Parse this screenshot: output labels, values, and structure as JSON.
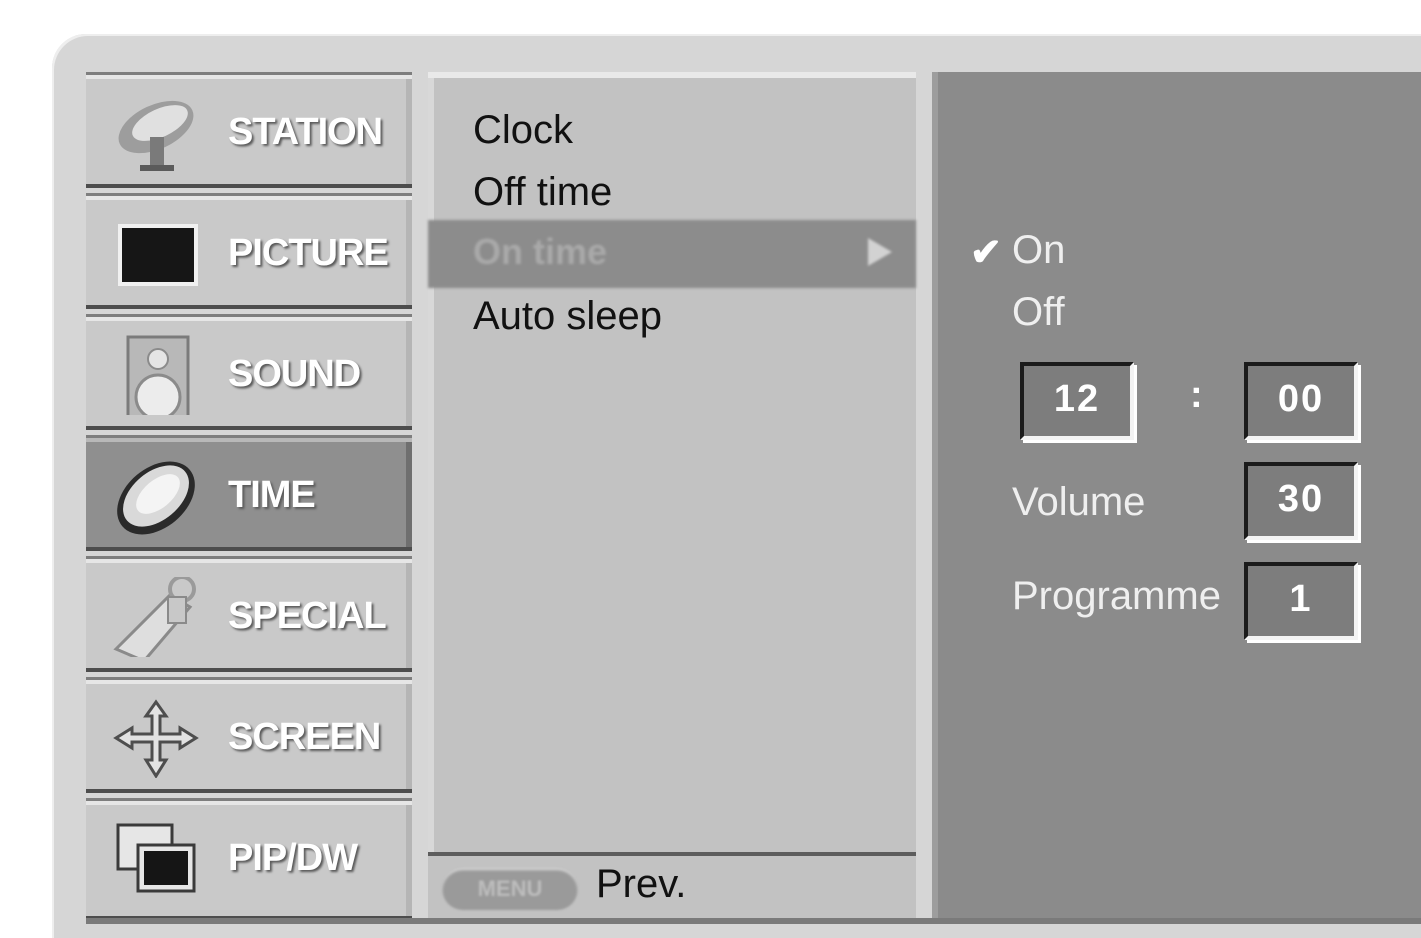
{
  "categories": [
    {
      "label": "STATION",
      "icon": "satellite-dish-icon",
      "active": false
    },
    {
      "label": "PICTURE",
      "icon": "picture-screen-icon",
      "active": false
    },
    {
      "label": "SOUND",
      "icon": "speaker-icon",
      "active": false
    },
    {
      "label": "TIME",
      "icon": "clock-icon",
      "active": true
    },
    {
      "label": "SPECIAL",
      "icon": "remote-hand-icon",
      "active": false
    },
    {
      "label": "SCREEN",
      "icon": "move-arrows-icon",
      "active": false
    },
    {
      "label": "PIP/DW",
      "icon": "pip-windows-icon",
      "active": false
    }
  ],
  "submenu": {
    "items": [
      {
        "label": "Clock",
        "selected": false
      },
      {
        "label": "Off time",
        "selected": false
      },
      {
        "label": "On time",
        "selected": true
      },
      {
        "label": "Auto sleep",
        "selected": false
      }
    ],
    "footer": {
      "button_label": "MENU",
      "prev_label": "Prev."
    }
  },
  "on_time": {
    "options": [
      {
        "label": "On",
        "checked": true
      },
      {
        "label": "Off",
        "checked": false
      }
    ],
    "check_glyph": "✔",
    "hour": "12",
    "separator": ":",
    "minute": "00",
    "volume_label": "Volume",
    "volume_value": "30",
    "programme_label": "Programme",
    "programme_value": "1"
  }
}
